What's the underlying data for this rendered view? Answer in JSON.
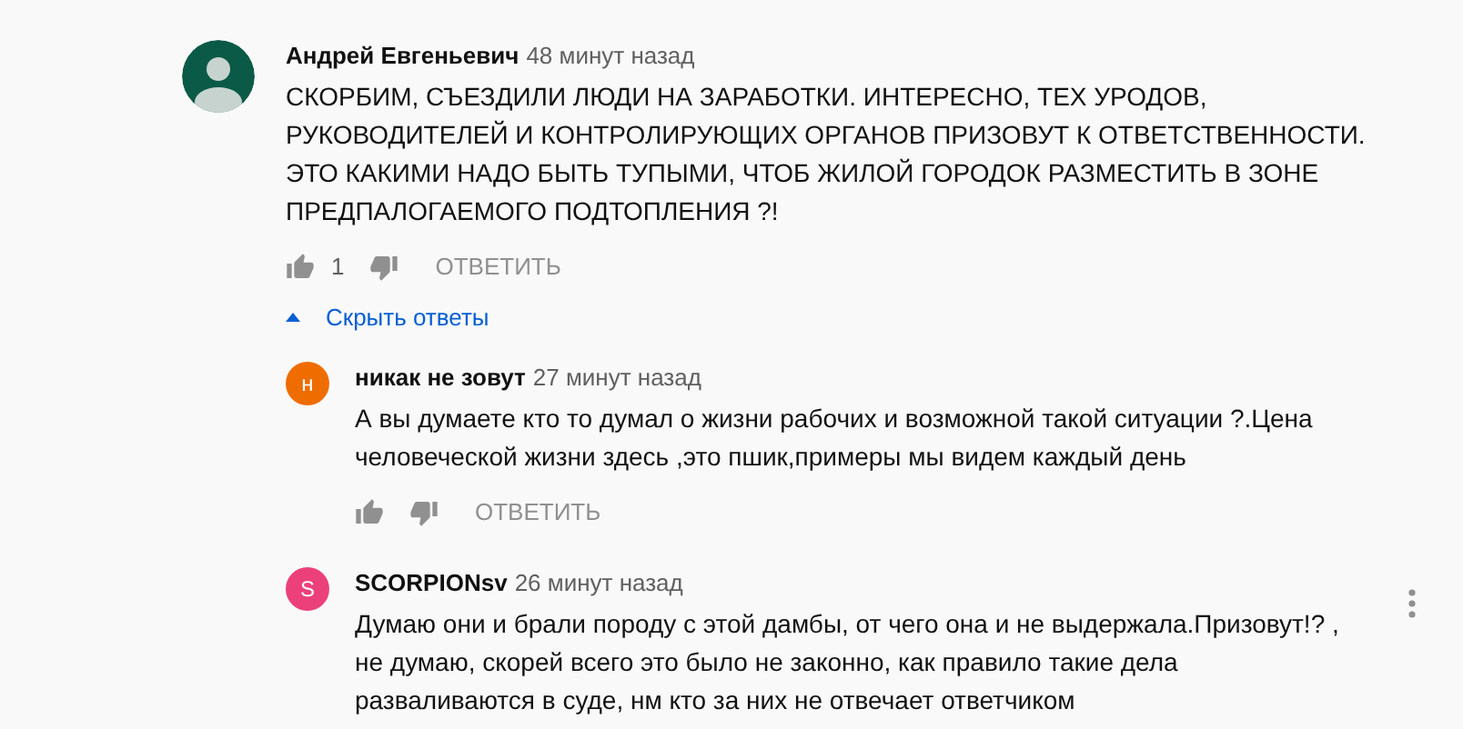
{
  "comment": {
    "avatar": {
      "kind": "silhouette",
      "color": "#0b5a47"
    },
    "author": "Андрей Евгеньевич",
    "time": "48 минут назад",
    "text": "СКОРБИМ, СЪЕЗДИЛИ ЛЮДИ НА ЗАРАБОТКИ. ИНТЕРЕСНО, ТЕХ УРОДОВ, РУКОВОДИТЕЛЕЙ И КОНТРОЛИРУЮЩИХ ОРГАНОВ ПРИЗОВУТ К ОТВЕТСТВЕННОСТИ. ЭТО КАКИМИ НАДО БЫТЬ ТУПЫМИ, ЧТОБ ЖИЛОЙ ГОРОДОК РАЗМЕСТИТЬ В ЗОНЕ ПРЕДПАЛОГАЕМОГО ПОДТОПЛЕНИЯ ?!",
    "likes": "1",
    "reply_button": "ОТВЕТИТЬ",
    "menu_shown": false,
    "replies_toggle": {
      "label": "Скрыть ответы",
      "expanded": true
    },
    "replies": [
      {
        "avatar": {
          "kind": "letter",
          "letter": "н",
          "color": "#ef6c00"
        },
        "author": "никак не зовут",
        "time": "27 минут назад",
        "text": "А вы думаете кто то думал о жизни рабочих и возможной такой ситуации ?.Цена человеческой жизни здесь ,это пшик,примеры мы видем каждый день",
        "reply_button": "ОТВЕТИТЬ",
        "menu_shown": false
      },
      {
        "avatar": {
          "kind": "letter",
          "letter": "S",
          "color": "#ec407a"
        },
        "author": "SCORPIONsv",
        "time": "26 минут назад",
        "text": "Думаю они и брали породу с этой дамбы, от чего она и не выдержала.Призовут!? ,\nне думаю, скорей всего это было не законно, как правило такие дела\nразваливаются в суде,  нм кто за них не отвечает ответчиком",
        "menu_shown": true
      }
    ]
  }
}
